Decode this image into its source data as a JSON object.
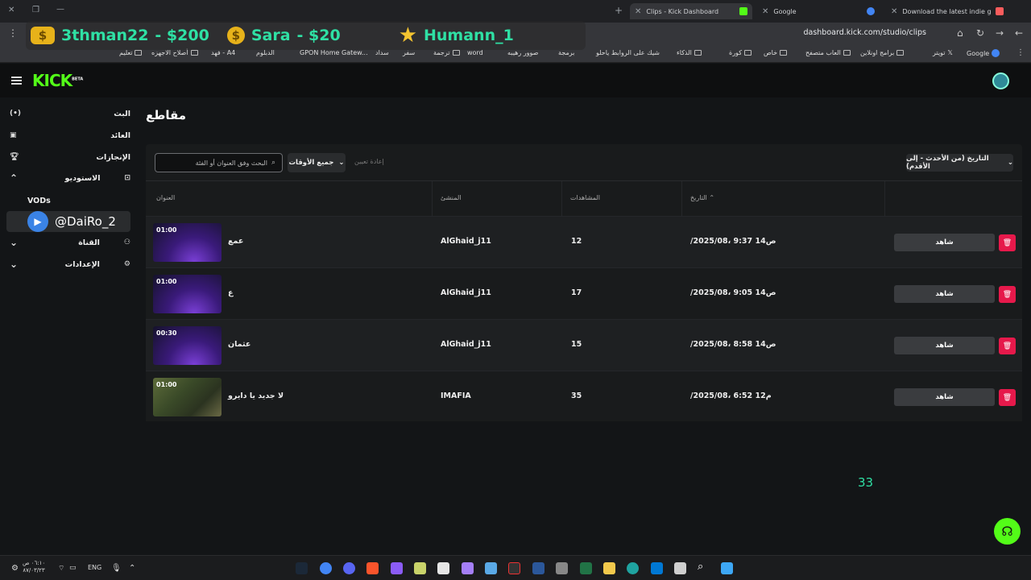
{
  "browser": {
    "tabs": [
      {
        "label": "Download the latest indie game",
        "icon": "itch-icon"
      },
      {
        "label": "Google",
        "icon": "google-icon"
      },
      {
        "label": "Clips - Kick Dashboard",
        "icon": "kick-icon"
      }
    ],
    "url": "dashboard.kick.com/studio/clips",
    "bookmarks": [
      "Google",
      "تويتر",
      "برامج اونلاين",
      "العاب متصفح",
      "خاص",
      "كورة",
      "الذكاء",
      "شيك على الروابط ياحلو",
      "برمجة",
      "صوور رهيبه",
      "word",
      "ترجمة",
      "سفر",
      "سداد",
      "GPON Home Gatew...",
      "الدبلوم",
      "فهد - A4",
      "أصلاح الاجهزه",
      "تعليم"
    ]
  },
  "overlay": {
    "donations": [
      {
        "name": "3thman22",
        "amount": "- $200",
        "icon": "coin-stack-icon"
      },
      {
        "name": "Sara",
        "amount": "- $20",
        "icon": "dollar-coin-icon"
      },
      {
        "name": "Humann_1",
        "amount": "",
        "icon": "star-icon"
      }
    ],
    "user": "@DaiRo_2",
    "counter": "33"
  },
  "app": {
    "logo": "KICK",
    "logo_badge": "BETA",
    "sidebar": [
      {
        "label": "البث",
        "icon": "broadcast-icon"
      },
      {
        "label": "العائد",
        "icon": "revenue-icon"
      },
      {
        "label": "الإنجازات",
        "icon": "trophy-icon"
      },
      {
        "label": "الاستوديو",
        "icon": "studio-icon"
      },
      {
        "label": "VODs",
        "icon": ""
      },
      {
        "label": "القناة",
        "icon": "channel-icon"
      },
      {
        "label": "الإعدادات",
        "icon": "settings-icon"
      }
    ],
    "page_title": "مقاطع",
    "filters": {
      "search_placeholder": "البحث وفق العنوان أو الفئة",
      "all_times": "جميع الأوقات",
      "reset": "إعادة تعيين",
      "sort": "التاريخ (من الأحدث - إلى الأقدم)"
    },
    "columns": {
      "title": "العنوان",
      "creator": "المنشئ",
      "views": "المشاهدات",
      "date": "التاريخ"
    },
    "watch_label": "شاهد",
    "clips": [
      {
        "duration": "01:00",
        "title": "عمع",
        "creator": "AlGhaid_j11",
        "views": "12",
        "date": "/2025/08، 9:37 ص14"
      },
      {
        "duration": "01:00",
        "title": "ع",
        "creator": "AlGhaid_j11",
        "views": "17",
        "date": "/2025/08، 9:05 ص14"
      },
      {
        "duration": "00:30",
        "title": "عثمان",
        "creator": "AlGhaid_j11",
        "views": "15",
        "date": "/2025/08، 8:58 ص14"
      },
      {
        "duration": "01:00",
        "title": "لا جديد يا دايرو",
        "creator": "IMAFIA",
        "views": "35",
        "date": "/2025/08، 6:52 م12"
      }
    ]
  },
  "taskbar": {
    "lang": "ENG",
    "clock_time": "٠٦:١٠ ص",
    "clock_date": "٨٧/٠٣/٢٣"
  }
}
